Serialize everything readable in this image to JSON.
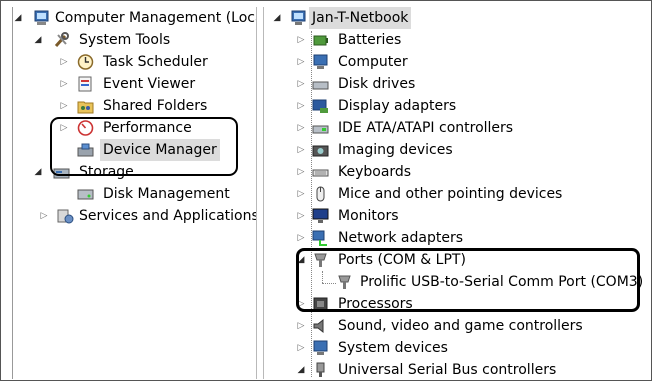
{
  "left_tree": {
    "root": "Computer Management (Local",
    "system_tools": "System Tools",
    "task_scheduler": "Task Scheduler",
    "event_viewer": "Event Viewer",
    "shared_folders": "Shared Folders",
    "performance": "Performance",
    "device_manager": "Device Manager",
    "storage": "Storage",
    "disk_management": "Disk Management",
    "services": "Services and Applications"
  },
  "device_tree": {
    "computer_name": "Jan-T-Netbook",
    "categories": [
      "Batteries",
      "Computer",
      "Disk drives",
      "Display adapters",
      "IDE ATA/ATAPI controllers",
      "Imaging devices",
      "Keyboards",
      "Mice and other pointing devices",
      "Monitors",
      "Network adapters",
      "Ports (COM & LPT)",
      "Processors",
      "Sound, video and game controllers",
      "System devices",
      "Universal Serial Bus controllers"
    ],
    "port_device": "Prolific USB-to-Serial Comm Port (COM3)"
  },
  "colors": {
    "selection": "#dcdcdc",
    "highlight_border": "#000000"
  }
}
